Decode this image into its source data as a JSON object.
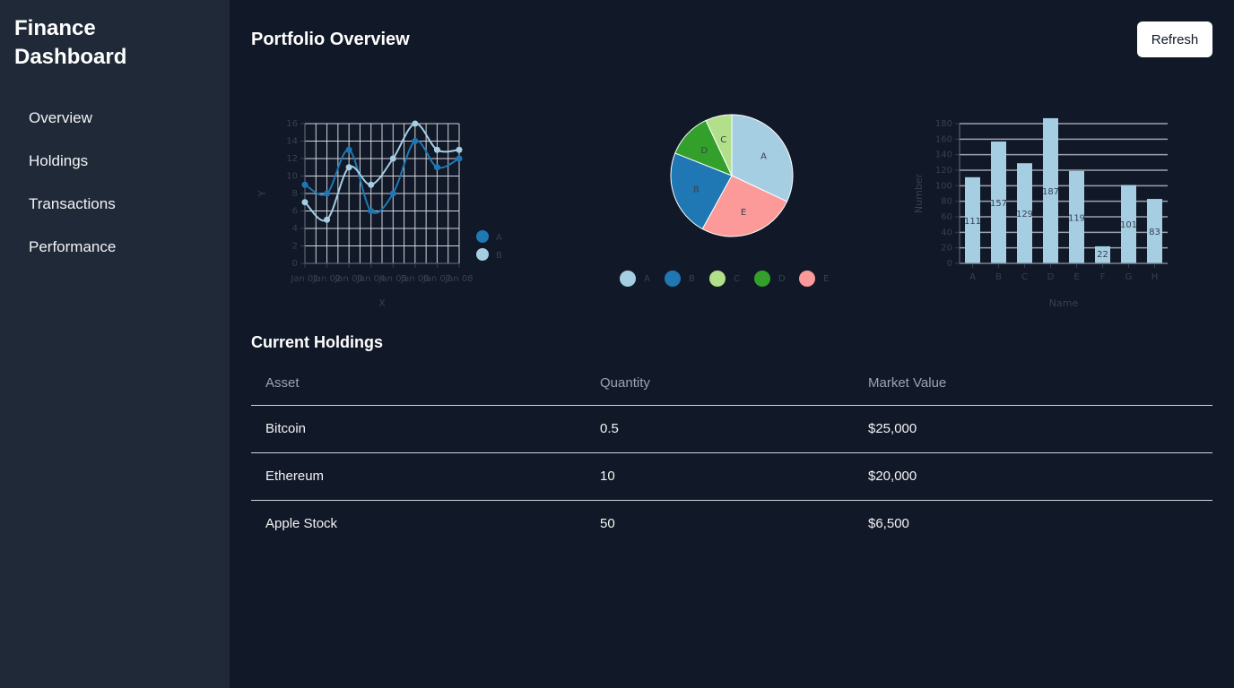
{
  "sidebar": {
    "title": "Finance Dashboard",
    "items": [
      {
        "label": "Overview"
      },
      {
        "label": "Holdings"
      },
      {
        "label": "Transactions"
      },
      {
        "label": "Performance"
      }
    ]
  },
  "header": {
    "title": "Portfolio Overview",
    "refresh_label": "Refresh"
  },
  "colors": {
    "background": "#111827",
    "sidebar": "#1f2937",
    "series_dark_blue": "#1f78b4",
    "series_light_blue": "#a6cee3",
    "light_green": "#b2df8a",
    "green": "#33a02c",
    "pink": "#fb9a99"
  },
  "chart_data": [
    {
      "type": "line",
      "x": [
        "Jan 01",
        "Jan 02",
        "Jan 03",
        "Jan 04",
        "Jan 05",
        "Jan 06",
        "Jan 07",
        "Jan 08"
      ],
      "series": [
        {
          "name": "A",
          "values": [
            9,
            8,
            13,
            6,
            8,
            14,
            11,
            12
          ],
          "color": "#1f78b4"
        },
        {
          "name": "B",
          "values": [
            7,
            5,
            11,
            9,
            12,
            16,
            13,
            13
          ],
          "color": "#a6cee3"
        }
      ],
      "xlabel": "X",
      "ylabel": "Y",
      "ylim": [
        0,
        16
      ],
      "yticks": [
        0,
        2,
        4,
        6,
        8,
        10,
        12,
        14,
        16
      ],
      "grid": true,
      "legend": "right"
    },
    {
      "type": "pie",
      "slices": [
        {
          "label": "A",
          "value": 32,
          "color": "#a6cee3"
        },
        {
          "label": "E",
          "value": 26,
          "color": "#fb9a99"
        },
        {
          "label": "B",
          "value": 23,
          "color": "#1f78b4"
        },
        {
          "label": "D",
          "value": 12,
          "color": "#33a02c"
        },
        {
          "label": "C",
          "value": 7,
          "color": "#b2df8a"
        }
      ],
      "legend_order": [
        "A",
        "B",
        "C",
        "D",
        "E"
      ],
      "legend": "bottom"
    },
    {
      "type": "bar",
      "categories": [
        "A",
        "B",
        "C",
        "D",
        "E",
        "F",
        "G",
        "H"
      ],
      "values": [
        111,
        157,
        129,
        187,
        119,
        22,
        101,
        83
      ],
      "color": "#a6cee3",
      "xlabel": "Name",
      "ylabel": "Number",
      "ylim": [
        0,
        180
      ],
      "yticks": [
        0,
        20,
        40,
        60,
        80,
        100,
        120,
        140,
        160,
        180
      ],
      "grid": true
    }
  ],
  "holdings": {
    "title": "Current Holdings",
    "columns": [
      "Asset",
      "Quantity",
      "Market Value"
    ],
    "rows": [
      {
        "asset": "Bitcoin",
        "quantity": "0.5",
        "value": "$25,000"
      },
      {
        "asset": "Ethereum",
        "quantity": "10",
        "value": "$20,000"
      },
      {
        "asset": "Apple Stock",
        "quantity": "50",
        "value": "$6,500"
      }
    ]
  }
}
